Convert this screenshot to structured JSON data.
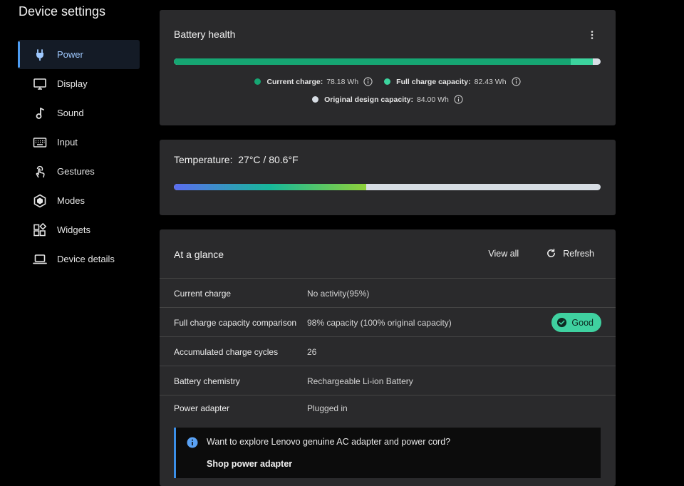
{
  "app": {
    "title": "Device settings"
  },
  "sidebar": {
    "items": [
      {
        "label": "Power",
        "icon": "power-plug-icon",
        "active": true
      },
      {
        "label": "Display",
        "icon": "monitor-icon"
      },
      {
        "label": "Sound",
        "icon": "music-note-icon"
      },
      {
        "label": "Input",
        "icon": "keyboard-icon"
      },
      {
        "label": "Gestures",
        "icon": "touch-gesture-icon"
      },
      {
        "label": "Modes",
        "icon": "hexagon-mode-icon"
      },
      {
        "label": "Widgets",
        "icon": "widgets-grid-icon"
      },
      {
        "label": "Device details",
        "icon": "laptop-icon"
      }
    ]
  },
  "battery_health": {
    "title": "Battery health",
    "bar": {
      "current_fraction": 0.9307,
      "full_fraction": 0.9813
    },
    "legend": [
      {
        "label": "Current charge:",
        "value": "78.18 Wh",
        "color": "#16a673"
      },
      {
        "label": "Full charge capacity:",
        "value": "82.43 Wh",
        "color": "#3cd49e"
      },
      {
        "label": "Original design capacity:",
        "value": "84.00 Wh",
        "color": "#d7dde4"
      }
    ]
  },
  "temperature": {
    "label": "Temperature:",
    "value": "27°C / 80.6°F",
    "bar_fraction": 0.45
  },
  "at_a_glance": {
    "title": "At a glance",
    "view_all_label": "View all",
    "refresh_label": "Refresh",
    "rows": [
      {
        "label": "Current charge",
        "value": "No activity(95%)"
      },
      {
        "label": "Full charge capacity comparison",
        "value": "98% capacity (100% original capacity)",
        "badge": "Good"
      },
      {
        "label": "Accumulated charge cycles",
        "value": "26"
      },
      {
        "label": "Battery chemistry",
        "value": "Rechargeable Li-ion Battery"
      },
      {
        "label": "Power adapter",
        "value": "Plugged in"
      }
    ],
    "notice": {
      "text": "Want to explore Lenovo genuine AC adapter and power cord?",
      "link": "Shop power adapter"
    }
  },
  "colors": {
    "accent": "#4d9cf2",
    "good_badge": "#3fd1a0",
    "temp_gradient": [
      "#5b6cf0",
      "#16b89a",
      "#8fd13a"
    ]
  }
}
